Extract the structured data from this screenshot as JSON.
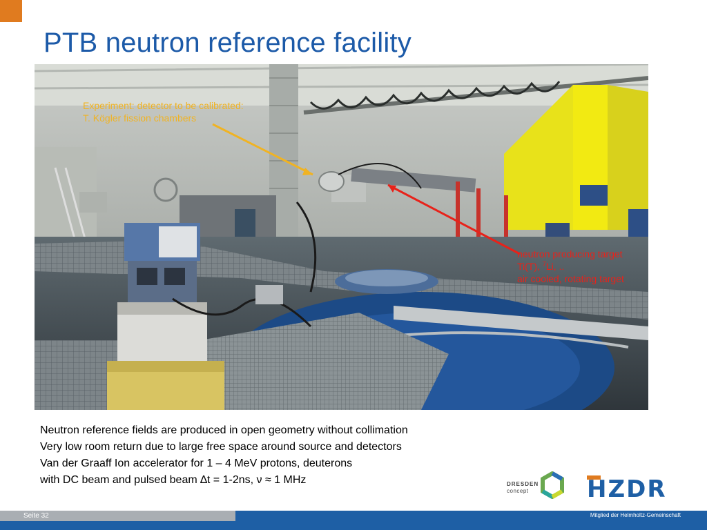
{
  "slide": {
    "title": "PTB neutron reference facility"
  },
  "photo": {
    "annotation_experiment": {
      "line1": "Experiment: detector to be calibrated:",
      "line2": "T. Kögler fission chambers",
      "color": "#f0b323"
    },
    "annotation_target": {
      "line1": "neutron producing target",
      "line2_pre": "Ti(T), ",
      "line2_sup": "7",
      "line2_post": "Li, ..",
      "line3": "air cooled, rotating target",
      "color": "#e8221a"
    }
  },
  "bullets": [
    "Neutron reference fields are produced in open geometry without collimation",
    "Very low room return due to large free space  around source and detectors",
    "Van der Graaff Ion accelerator for 1 – 4 MeV protons, deuterons",
    "with DC beam and pulsed beam ∆t = 1-2ns, ν ≈ 1 MHz"
  ],
  "logos": {
    "dresden_line1": "DRESDEN",
    "dresden_line2": "concept",
    "hzdr": "HZDR"
  },
  "footer": {
    "page": "Seite 32",
    "member": "Mitglied der Helmholtz-Gemeinschaft"
  },
  "colors": {
    "title": "#1c5aa8",
    "accent": "#e07b1f",
    "brand_blue": "#1e5fa5"
  }
}
